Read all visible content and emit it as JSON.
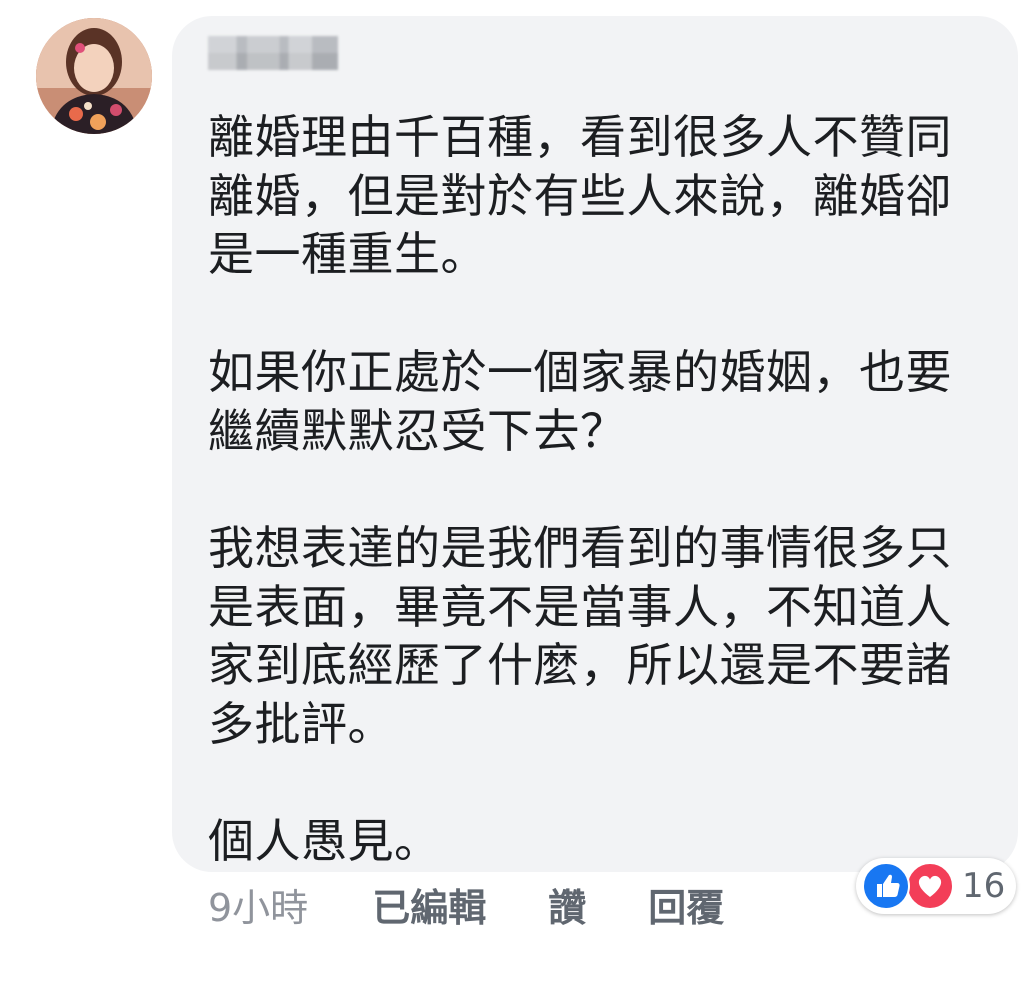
{
  "comment": {
    "author_name": "████",
    "text": "離婚理由千百種，看到很多人不贊同\n離婚，但是對於有些人來說，離婚卻\n是一種重生。\n\n如果你正處於一個家暴的婚姻，也要\n繼續默默忍受下去？\n\n我想表達的是我們看到的事情很多只\n是表面，畢竟不是當事人，不知道人\n家到底經歷了什麼，所以還是不要諸\n多批評。\n\n個人愚見。"
  },
  "meta": {
    "time": "9小時",
    "edited": "已編輯",
    "like": "讚",
    "reply": "回覆"
  },
  "reactions": {
    "count": "16",
    "types": [
      "like-icon",
      "love-icon"
    ],
    "like_color": "#1877f2",
    "love_color": "#f33e58"
  },
  "colors": {
    "bubble_bg": "#f2f3f5",
    "text": "#1c1e21",
    "meta_text": "#606770"
  }
}
